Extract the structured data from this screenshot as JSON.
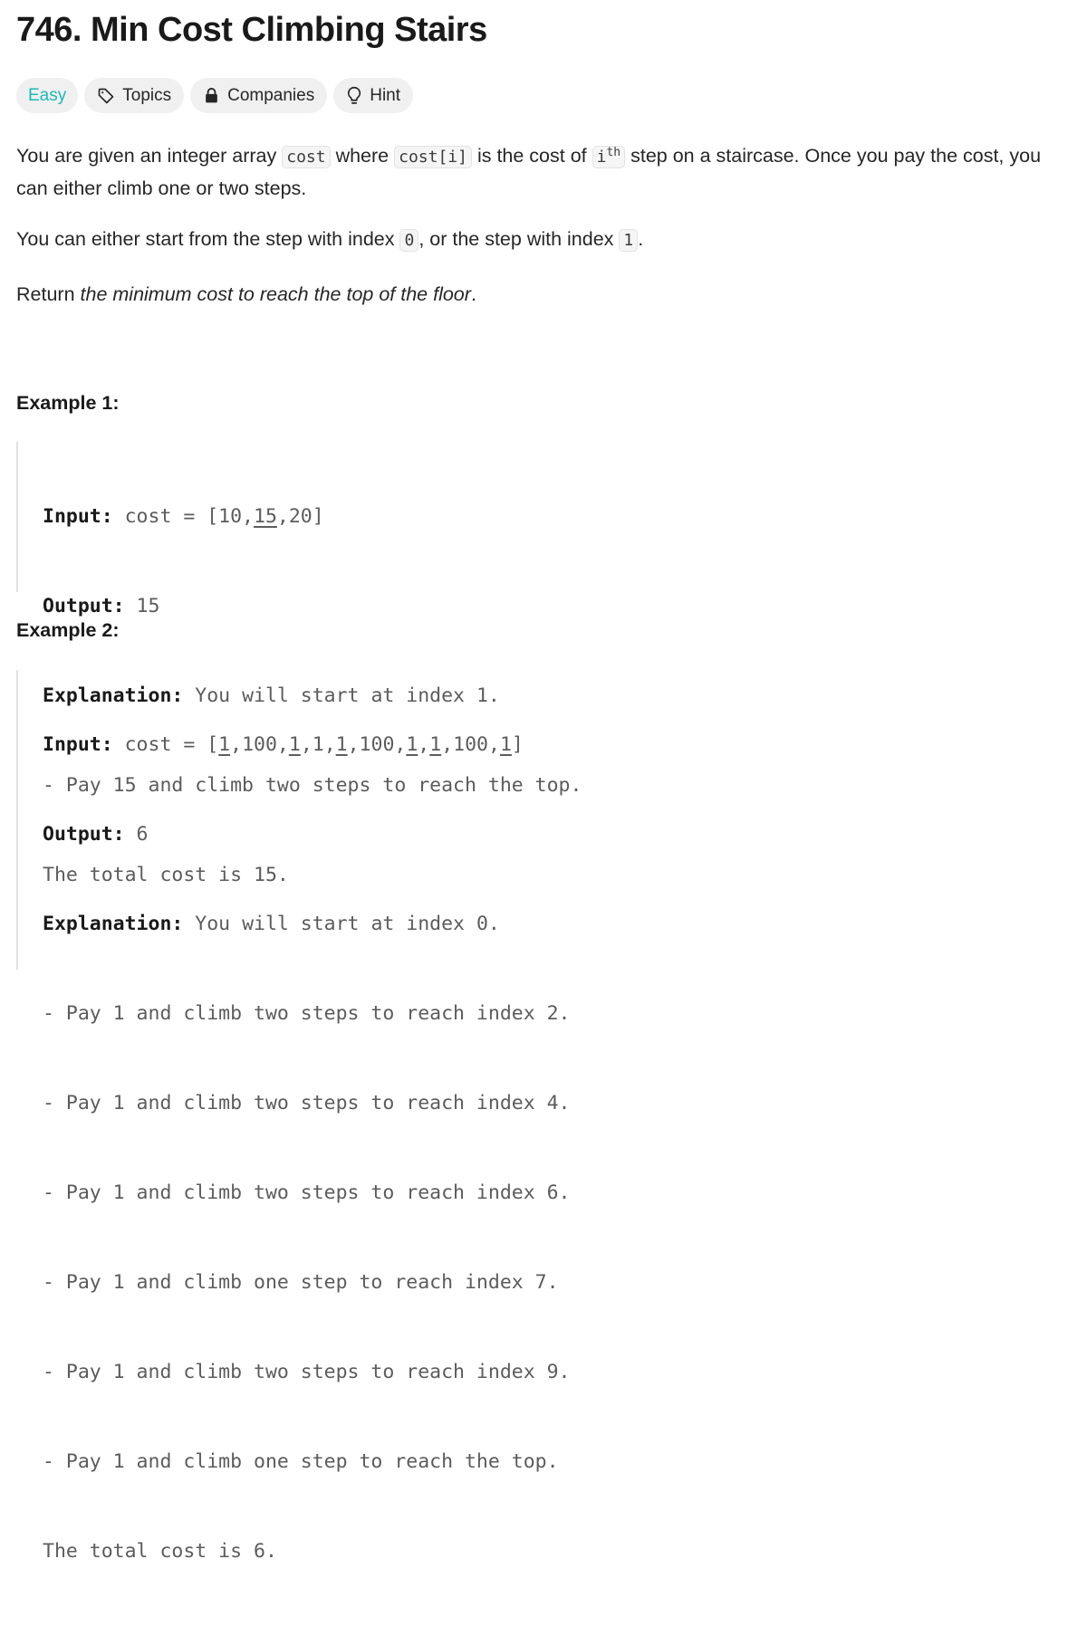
{
  "problem": {
    "title": "746. Min Cost Climbing Stairs",
    "difficulty": "Easy",
    "tags": {
      "topics": "Topics",
      "companies": "Companies",
      "hint": "Hint"
    }
  },
  "description": {
    "p1": {
      "t1": "You are given an integer array ",
      "c1": "cost",
      "t2": " where ",
      "c2": "cost[i]",
      "t3": " is the cost of ",
      "c3_base": "i",
      "c3_sup": "th",
      "t4": " step on a staircase. Once you pay the cost, you can either climb one or two steps."
    },
    "p2": {
      "t1": "You can either start from the step with index ",
      "c1": "0",
      "t2": ", or the step with index ",
      "c2": "1",
      "t3": "."
    },
    "p3": {
      "t1": "Return ",
      "em": "the minimum cost to reach the top of the floor",
      "t2": "."
    }
  },
  "examples": [
    {
      "title": "Example 1:",
      "input_label": "Input:",
      "input_prefix": " cost = [10,",
      "input_u1": "15",
      "input_suffix": ",20]",
      "output_label": "Output:",
      "output_value": " 15",
      "explanation_label": "Explanation:",
      "explanation_first": " You will start at index 1.",
      "lines": [
        "- Pay 15 and climb two steps to reach the top.",
        "The total cost is 15."
      ]
    },
    {
      "title": "Example 2:",
      "input_label": "Input:",
      "input_prefix": " cost = [",
      "input_parts": [
        "1",
        ",100,",
        "1",
        ",1,",
        "1",
        ",100,",
        "1",
        ",",
        "1",
        ",100,",
        "1",
        "]"
      ],
      "output_label": "Output:",
      "output_value": " 6",
      "explanation_label": "Explanation:",
      "explanation_first": " You will start at index 0.",
      "lines": [
        "- Pay 1 and climb two steps to reach index 2.",
        "- Pay 1 and climb two steps to reach index 4.",
        "- Pay 1 and climb two steps to reach index 6.",
        "- Pay 1 and climb one step to reach index 7.",
        "- Pay 1 and climb two steps to reach index 9.",
        "- Pay 1 and climb one step to reach the top.",
        "The total cost is 6."
      ]
    }
  ]
}
